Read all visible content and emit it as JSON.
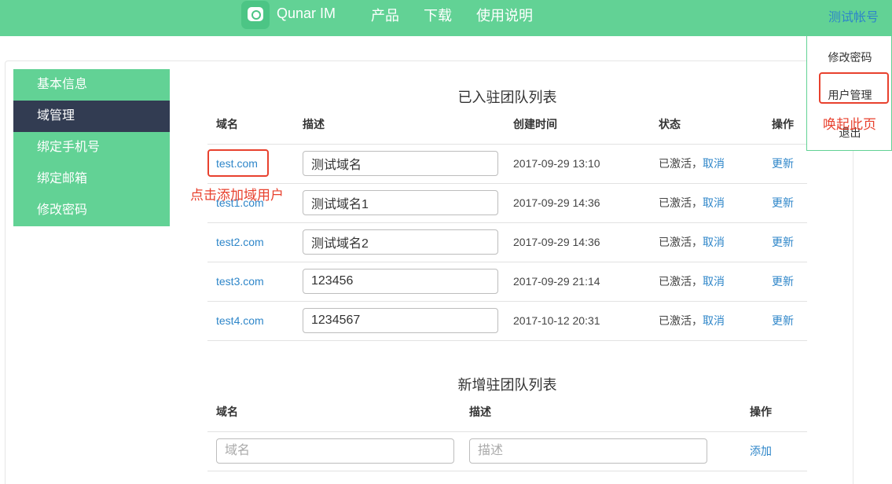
{
  "header": {
    "brand": "Qunar IM",
    "nav": [
      "产品",
      "下载",
      "使用说明"
    ],
    "account": "测试帐号"
  },
  "colors": {
    "accent": "#62d295",
    "sidebar_active": "#323c52",
    "link": "#2e86c9",
    "annotation": "#e8412e"
  },
  "sidebar": {
    "items": [
      {
        "label": "基本信息",
        "active": false
      },
      {
        "label": "域管理",
        "active": true
      },
      {
        "label": "绑定手机号",
        "active": false
      },
      {
        "label": "绑定邮箱",
        "active": false
      },
      {
        "label": "修改密码",
        "active": false
      }
    ]
  },
  "joined": {
    "title": "已入驻团队列表",
    "columns": [
      "域名",
      "描述",
      "创建时间",
      "状态",
      "操作"
    ],
    "rows": [
      {
        "domain": "test.com",
        "desc": "测试域名",
        "created": "2017-09-29 13:10",
        "status": "已激活，",
        "cancel": "取消",
        "action": "更新"
      },
      {
        "domain": "test1.com",
        "desc": "测试域名1",
        "created": "2017-09-29 14:36",
        "status": "已激活，",
        "cancel": "取消",
        "action": "更新"
      },
      {
        "domain": "test2.com",
        "desc": "测试域名2",
        "created": "2017-09-29 14:36",
        "status": "已激活，",
        "cancel": "取消",
        "action": "更新"
      },
      {
        "domain": "test3.com",
        "desc": "123456",
        "created": "2017-09-29 21:14",
        "status": "已激活，",
        "cancel": "取消",
        "action": "更新"
      },
      {
        "domain": "test4.com",
        "desc": "1234567",
        "created": "2017-10-12 20:31",
        "status": "已激活，",
        "cancel": "取消",
        "action": "更新"
      }
    ]
  },
  "newteam": {
    "title": "新增驻团队列表",
    "columns": [
      "域名",
      "描述",
      "操作"
    ],
    "domain_placeholder": "域名",
    "desc_placeholder": "描述",
    "add_label": "添加"
  },
  "dropdown": {
    "items": [
      "修改密码",
      "用户管理",
      "退出"
    ]
  },
  "annotations": {
    "click_add": "点击添加域用户",
    "open_page": "唤起此页"
  }
}
